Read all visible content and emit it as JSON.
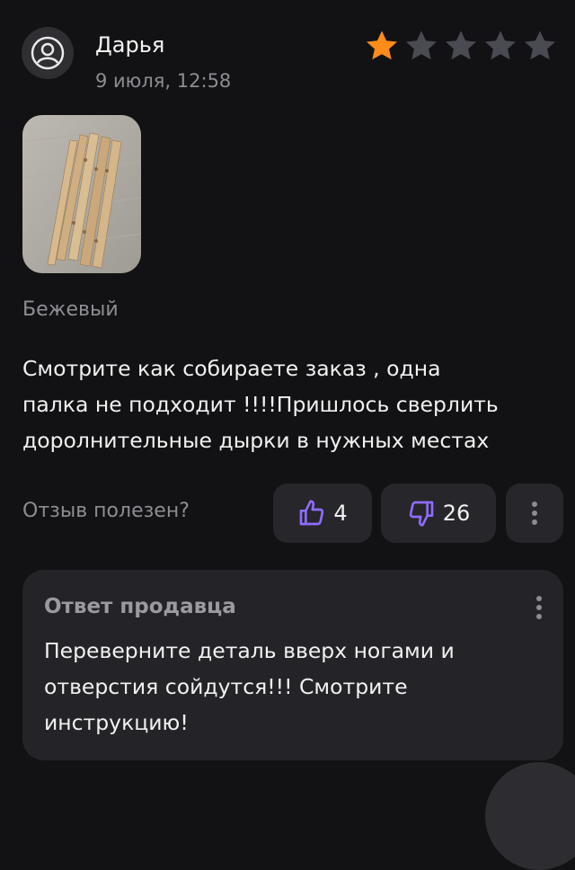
{
  "review": {
    "author": "Дарья",
    "date": "9 июля, 12:58",
    "rating": 1,
    "rating_max": 5,
    "variant": "Бежевый",
    "text": "Смотрите как собираете заказ , одна\nпалка не подходит !!!!Пришлось сверлить\nдоролнительные дырки в нужных местах"
  },
  "helpful": {
    "label": "Отзыв полезен?",
    "likes": "4",
    "dislikes": "26"
  },
  "seller_reply": {
    "title": "Ответ продавца",
    "text": "Переверните деталь вверх ногами и\nотверстия сойдутся!!! Смотрите\nинструкцию!"
  },
  "colors": {
    "background": "#121214",
    "star_active": "#ff8c1a",
    "star_inactive": "#4a4a52",
    "button_bg": "#26262b",
    "reply_bg": "#242428"
  },
  "icons": {
    "avatar": "user-circle-icon",
    "like": "thumbs-up-icon",
    "dislike": "thumbs-down-icon",
    "more": "more-vertical-icon"
  }
}
